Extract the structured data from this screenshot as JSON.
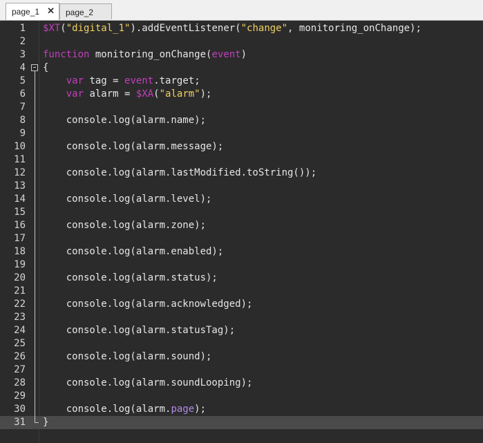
{
  "tabs": [
    {
      "label": "page_1",
      "active": true,
      "close_glyph": "✕"
    },
    {
      "label": "page_2",
      "active": false
    }
  ],
  "colors": {
    "keyword": "#c23fbd",
    "string": "#f0d060",
    "text": "#e6e6e6",
    "background": "#2b2b2b",
    "current_line": "#4a4a4a"
  },
  "editor": {
    "current_line": 31,
    "fold_marker_line": 4,
    "lines": [
      {
        "n": "1",
        "segs": [
          [
            "var",
            "$XT"
          ],
          [
            "t",
            "("
          ],
          [
            "str",
            "\"digital_1\""
          ],
          [
            "t",
            ").addEventListener("
          ],
          [
            "str",
            "\"change\""
          ],
          [
            "t",
            ", monitoring_onChange);"
          ]
        ]
      },
      {
        "n": "2",
        "segs": []
      },
      {
        "n": "3",
        "segs": [
          [
            "kw",
            "function"
          ],
          [
            "t",
            " monitoring_onChange("
          ],
          [
            "var",
            "event"
          ],
          [
            "t",
            ")"
          ]
        ]
      },
      {
        "n": "4",
        "segs": [
          [
            "t",
            "{"
          ]
        ]
      },
      {
        "n": "5",
        "segs": [
          [
            "t",
            "    "
          ],
          [
            "kw",
            "var"
          ],
          [
            "t",
            " tag = "
          ],
          [
            "var",
            "event"
          ],
          [
            "t",
            ".target;"
          ]
        ]
      },
      {
        "n": "6",
        "segs": [
          [
            "t",
            "    "
          ],
          [
            "kw",
            "var"
          ],
          [
            "t",
            " alarm = "
          ],
          [
            "var",
            "$XA"
          ],
          [
            "t",
            "("
          ],
          [
            "str",
            "\"alarm\""
          ],
          [
            "t",
            ");"
          ]
        ]
      },
      {
        "n": "7",
        "segs": []
      },
      {
        "n": "8",
        "segs": [
          [
            "t",
            "    console.log(alarm.name);"
          ]
        ]
      },
      {
        "n": "9",
        "segs": []
      },
      {
        "n": "10",
        "segs": [
          [
            "t",
            "    console.log(alarm.message);"
          ]
        ]
      },
      {
        "n": "11",
        "segs": []
      },
      {
        "n": "12",
        "segs": [
          [
            "t",
            "    console.log(alarm.lastModified.toString());"
          ]
        ]
      },
      {
        "n": "13",
        "segs": []
      },
      {
        "n": "14",
        "segs": [
          [
            "t",
            "    console.log(alarm.level);"
          ]
        ]
      },
      {
        "n": "15",
        "segs": []
      },
      {
        "n": "16",
        "segs": [
          [
            "t",
            "    console.log(alarm.zone);"
          ]
        ]
      },
      {
        "n": "17",
        "segs": []
      },
      {
        "n": "18",
        "segs": [
          [
            "t",
            "    console.log(alarm.enabled);"
          ]
        ]
      },
      {
        "n": "19",
        "segs": []
      },
      {
        "n": "20",
        "segs": [
          [
            "t",
            "    console.log(alarm.status);"
          ]
        ]
      },
      {
        "n": "21",
        "segs": []
      },
      {
        "n": "22",
        "segs": [
          [
            "t",
            "    console.log(alarm.acknowledged);"
          ]
        ]
      },
      {
        "n": "23",
        "segs": []
      },
      {
        "n": "24",
        "segs": [
          [
            "t",
            "    console.log(alarm.statusTag);"
          ]
        ]
      },
      {
        "n": "25",
        "segs": []
      },
      {
        "n": "26",
        "segs": [
          [
            "t",
            "    console.log(alarm.sound);"
          ]
        ]
      },
      {
        "n": "27",
        "segs": []
      },
      {
        "n": "28",
        "segs": [
          [
            "t",
            "    console.log(alarm.soundLooping);"
          ]
        ]
      },
      {
        "n": "29",
        "segs": []
      },
      {
        "n": "30",
        "segs": [
          [
            "t",
            "    console.log(alarm."
          ],
          [
            "acc",
            "page"
          ],
          [
            "t",
            ");"
          ]
        ]
      },
      {
        "n": "31",
        "segs": [
          [
            "t",
            "}"
          ]
        ]
      }
    ]
  }
}
